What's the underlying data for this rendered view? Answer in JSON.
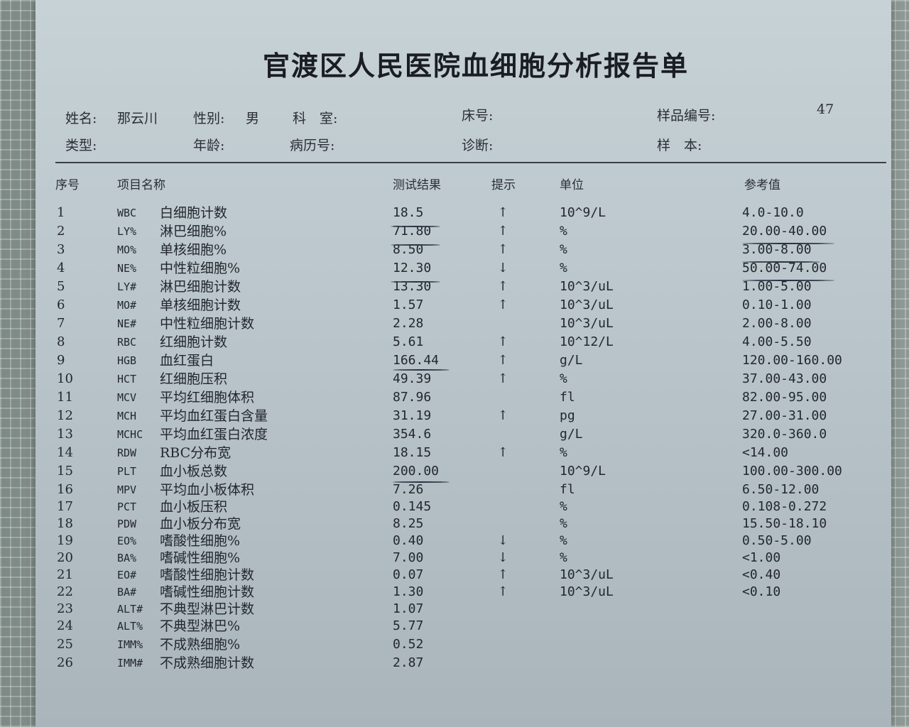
{
  "report": {
    "title": "官渡区人民医院血细胞分析报告单",
    "fields": {
      "name_label": "姓名:",
      "name_value": "那云川",
      "sex_label": "性别:",
      "sex_value": "男",
      "dept_label": "科　室:",
      "bed_label": "床号:",
      "sample_no_label": "样品编号:",
      "sample_no_value": "47",
      "type_label": "类型:",
      "age_label": "年龄:",
      "record_label": "病历号:",
      "diagnosis_label": "诊断:",
      "specimen_label": "样　本:"
    },
    "columns": {
      "no": "序号",
      "item": "项目名称",
      "result": "测试结果",
      "flag": "提示",
      "unit": "单位",
      "ref": "参考值"
    },
    "rows": [
      {
        "no": "1",
        "code": "WBC",
        "name": "白细胞计数",
        "result": "18.5",
        "flag": "↑",
        "unit": "10^9/L",
        "ref": "4.0-10.0"
      },
      {
        "no": "2",
        "code": "LY%",
        "name": "淋巴细胞%",
        "result": "71.80",
        "flag": "↑",
        "unit": "%",
        "ref": "20.00-40.00"
      },
      {
        "no": "3",
        "code": "MO%",
        "name": "单核细胞%",
        "result": "8.50",
        "flag": "↑",
        "unit": "%",
        "ref": "3.00-8.00"
      },
      {
        "no": "4",
        "code": "NE%",
        "name": "中性粒细胞%",
        "result": "12.30",
        "flag": "↓",
        "unit": "%",
        "ref": "50.00-74.00"
      },
      {
        "no": "5",
        "code": "LY#",
        "name": "淋巴细胞计数",
        "result": "13.30",
        "flag": "↑",
        "unit": "10^3/uL",
        "ref": "1.00-5.00"
      },
      {
        "no": "6",
        "code": "MO#",
        "name": "单核细胞计数",
        "result": "1.57",
        "flag": "↑",
        "unit": "10^3/uL",
        "ref": "0.10-1.00"
      },
      {
        "no": "7",
        "code": "NE#",
        "name": "中性粒细胞计数",
        "result": "2.28",
        "flag": "",
        "unit": "10^3/uL",
        "ref": "2.00-8.00"
      },
      {
        "no": "8",
        "code": "RBC",
        "name": "红细胞计数",
        "result": "5.61",
        "flag": "↑",
        "unit": "10^12/L",
        "ref": "4.00-5.50"
      },
      {
        "no": "9",
        "code": "HGB",
        "name": "血红蛋白",
        "result": "166.44",
        "flag": "↑",
        "unit": "g/L",
        "ref": "120.00-160.00"
      },
      {
        "no": "10",
        "code": "HCT",
        "name": "红细胞压积",
        "result": "49.39",
        "flag": "↑",
        "unit": "%",
        "ref": "37.00-43.00"
      },
      {
        "no": "11",
        "code": "MCV",
        "name": "平均红细胞体积",
        "result": "87.96",
        "flag": "",
        "unit": "fl",
        "ref": "82.00-95.00"
      },
      {
        "no": "12",
        "code": "MCH",
        "name": "平均血红蛋白含量",
        "result": "31.19",
        "flag": "↑",
        "unit": "pg",
        "ref": "27.00-31.00"
      },
      {
        "no": "13",
        "code": "MCHC",
        "name": "平均血红蛋白浓度",
        "result": "354.6",
        "flag": "",
        "unit": "g/L",
        "ref": "320.0-360.0"
      },
      {
        "no": "14",
        "code": "RDW",
        "name": "RBC分布宽",
        "result": "18.15",
        "flag": "↑",
        "unit": "%",
        "ref": "<14.00"
      },
      {
        "no": "15",
        "code": "PLT",
        "name": "血小板总数",
        "result": "200.00",
        "flag": "",
        "unit": "10^9/L",
        "ref": "100.00-300.00"
      },
      {
        "no": "16",
        "code": "MPV",
        "name": "平均血小板体积",
        "result": "7.26",
        "flag": "",
        "unit": "fl",
        "ref": "6.50-12.00"
      },
      {
        "no": "17",
        "code": "PCT",
        "name": "血小板压积",
        "result": "0.145",
        "flag": "",
        "unit": "%",
        "ref": "0.108-0.272"
      },
      {
        "no": "18",
        "code": "PDW",
        "name": "血小板分布宽",
        "result": "8.25",
        "flag": "",
        "unit": "%",
        "ref": "15.50-18.10"
      },
      {
        "no": "19",
        "code": "EO%",
        "name": "嗜酸性细胞%",
        "result": "0.40",
        "flag": "↓",
        "unit": "%",
        "ref": "0.50-5.00"
      },
      {
        "no": "20",
        "code": "BA%",
        "name": "嗜碱性细胞%",
        "result": "7.00",
        "flag": "↓",
        "unit": "%",
        "ref": "<1.00"
      },
      {
        "no": "21",
        "code": "EO#",
        "name": "嗜酸性细胞计数",
        "result": "0.07",
        "flag": "↑",
        "unit": "10^3/uL",
        "ref": "<0.40"
      },
      {
        "no": "22",
        "code": "BA#",
        "name": "嗜碱性细胞计数",
        "result": "1.30",
        "flag": "↑",
        "unit": "10^3/uL",
        "ref": "<0.10"
      },
      {
        "no": "23",
        "code": "ALT#",
        "name": "不典型淋巴计数",
        "result": "1.07",
        "flag": "",
        "unit": "",
        "ref": ""
      },
      {
        "no": "24",
        "code": "ALT%",
        "name": "不典型淋巴%",
        "result": "5.77",
        "flag": "",
        "unit": "",
        "ref": ""
      },
      {
        "no": "25",
        "code": "IMM%",
        "name": "不成熟细胞%",
        "result": "0.52",
        "flag": "",
        "unit": "",
        "ref": ""
      },
      {
        "no": "26",
        "code": "IMM#",
        "name": "不成熟细胞计数",
        "result": "2.87",
        "flag": "",
        "unit": "",
        "ref": ""
      }
    ]
  }
}
